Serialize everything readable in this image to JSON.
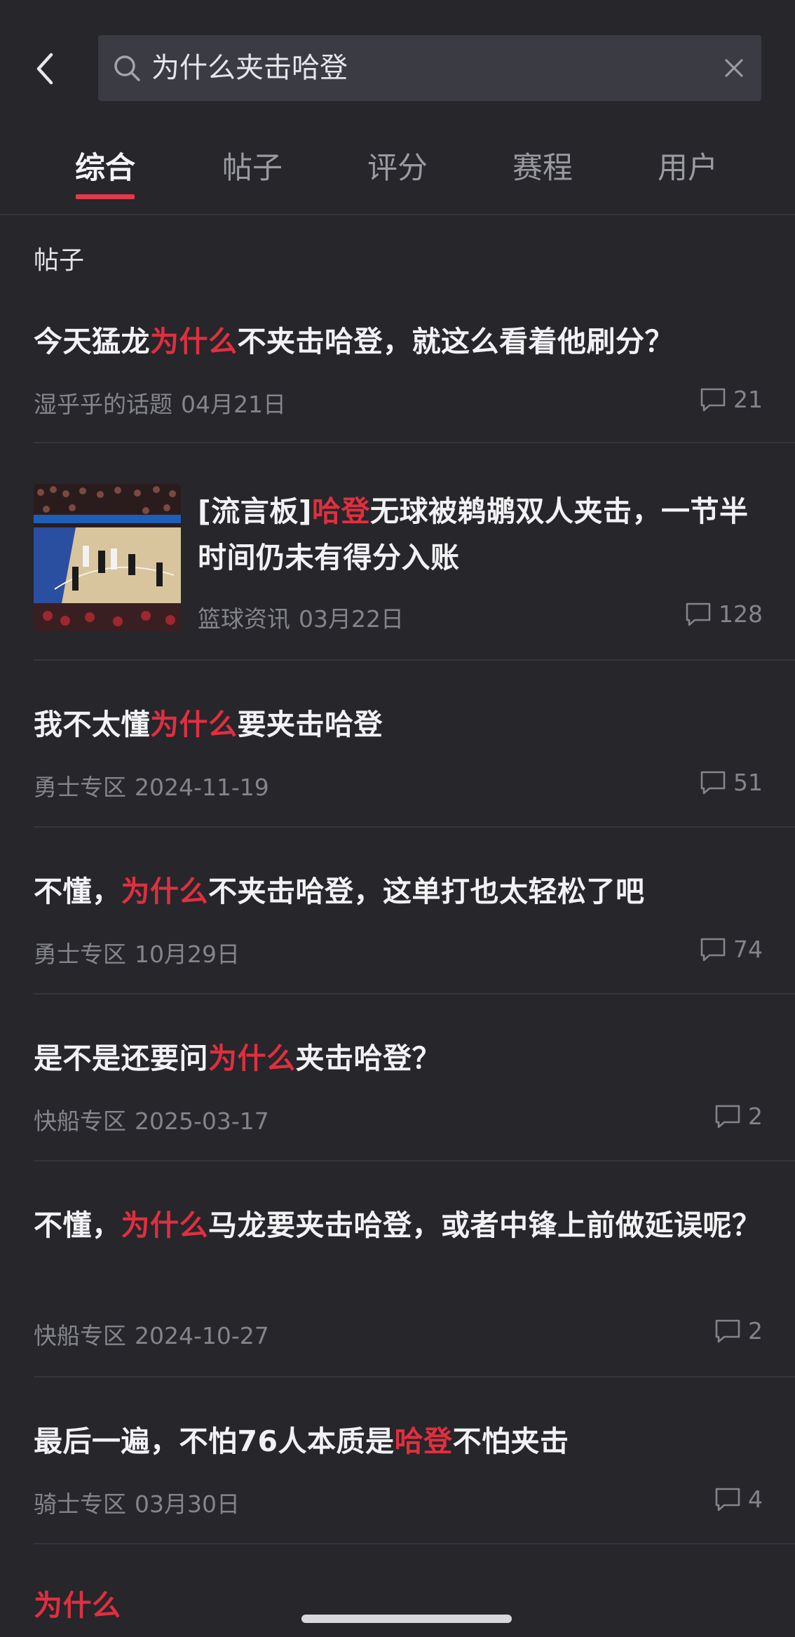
{
  "search": {
    "query": "为什么夹击哈登"
  },
  "tabs": [
    "综合",
    "帖子",
    "评分",
    "赛程",
    "用户"
  ],
  "section_label": "帖子",
  "posts": [
    {
      "title_parts": [
        {
          "t": "今天猛龙",
          "hl": false
        },
        {
          "t": "为什么",
          "hl": true
        },
        {
          "t": "不夹击哈登，就这么看着他刷分？",
          "hl": false
        }
      ],
      "source": "湿乎乎的话题",
      "date": "04月21日",
      "comments": "21"
    },
    {
      "title_parts": [
        {
          "t": "[流言板]",
          "hl": false
        },
        {
          "t": "哈登",
          "hl": true
        },
        {
          "t": "无球被鹈鹕双人夹击，一节半时间仍未有得分入账",
          "hl": false
        }
      ],
      "source": "篮球资讯",
      "date": "03月22日",
      "comments": "128"
    },
    {
      "title_parts": [
        {
          "t": "我不太懂",
          "hl": false
        },
        {
          "t": "为什么",
          "hl": true
        },
        {
          "t": "要夹击哈登",
          "hl": false
        }
      ],
      "source": "勇士专区",
      "date": "2024-11-19",
      "comments": "51"
    },
    {
      "title_parts": [
        {
          "t": "不懂，",
          "hl": false
        },
        {
          "t": "为什么",
          "hl": true
        },
        {
          "t": "不夹击哈登，这单打也太轻松了吧",
          "hl": false
        }
      ],
      "source": "勇士专区",
      "date": "10月29日",
      "comments": "74"
    },
    {
      "title_parts": [
        {
          "t": "是不是还要问",
          "hl": false
        },
        {
          "t": "为什么",
          "hl": true
        },
        {
          "t": "夹击哈登？",
          "hl": false
        }
      ],
      "source": "快船专区",
      "date": "2025-03-17",
      "comments": "2"
    },
    {
      "title_parts": [
        {
          "t": "不懂，",
          "hl": false
        },
        {
          "t": "为什么",
          "hl": true
        },
        {
          "t": "马龙要夹击哈登，或者中锋上前做延误呢？",
          "hl": false
        }
      ],
      "source": "快船专区",
      "date": "2024-10-27",
      "comments": "2"
    },
    {
      "title_parts": [
        {
          "t": "最后一遍，不怕76人本质是",
          "hl": false
        },
        {
          "t": "哈登",
          "hl": true
        },
        {
          "t": "不怕夹击",
          "hl": false
        }
      ],
      "source": "骑士专区",
      "date": "03月30日",
      "comments": "4"
    },
    {
      "title_parts": [
        {
          "t": "为什么",
          "hl": true
        }
      ],
      "source": "",
      "date": "",
      "comments": ""
    }
  ],
  "colors": {
    "background": "#26262b",
    "highlight": "#e02f3f",
    "tab_indicator": "#e0394b",
    "meta_text": "#84858c"
  }
}
